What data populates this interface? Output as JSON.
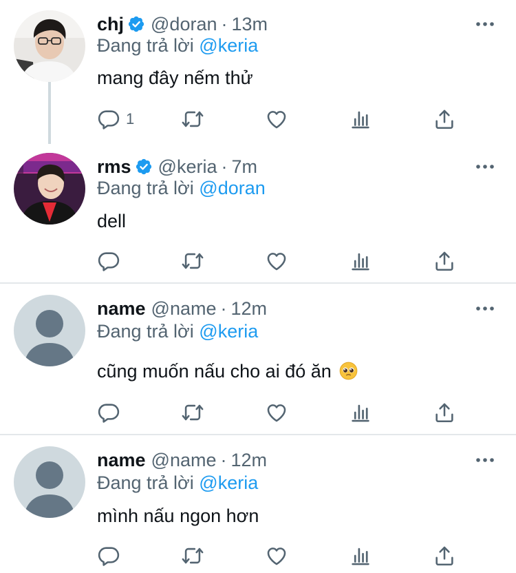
{
  "reply_prefix": "Đang trả lời",
  "colors": {
    "accent": "#1d9bf0",
    "muted": "#536471",
    "text": "#0f1419"
  },
  "tweets": [
    {
      "name": "chj",
      "verified": true,
      "handle": "@doran",
      "sep": "·",
      "time": "13m",
      "reply_to": "@keria",
      "text": "mang đây nếm thử",
      "reply_count": "1",
      "avatar_icon": "profile-photo"
    },
    {
      "name": "rms",
      "verified": true,
      "handle": "@keria",
      "sep": "·",
      "time": "7m",
      "reply_to": "@doran",
      "text": "dell",
      "reply_count": "",
      "avatar_icon": "profile-photo"
    },
    {
      "name": "name",
      "verified": false,
      "handle": "@name",
      "sep": "·",
      "time": "12m",
      "reply_to": "@keria",
      "text": "cũng muốn nấu cho ai đó ăn",
      "emoji": "pleading-face-emoji",
      "reply_count": "",
      "avatar_icon": "default-avatar-icon"
    },
    {
      "name": "name",
      "verified": false,
      "handle": "@name",
      "sep": "·",
      "time": "12m",
      "reply_to": "@keria",
      "text": "mình nấu ngon hơn",
      "reply_count": "",
      "avatar_icon": "default-avatar-icon"
    }
  ]
}
